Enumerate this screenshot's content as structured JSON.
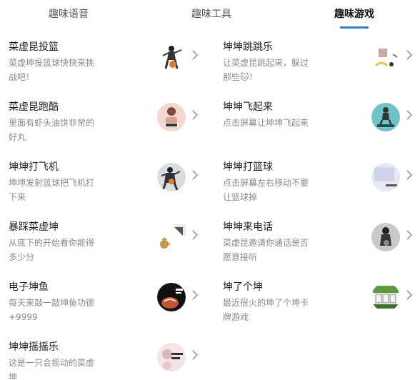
{
  "tabs": [
    {
      "label": "趣味语音"
    },
    {
      "label": "趣味工具"
    },
    {
      "label": "趣味游戏",
      "active": true
    }
  ],
  "colors": {
    "accent": "#2b7de9",
    "title": "#222222",
    "desc": "#8a8a8a",
    "chevron": "#999999"
  },
  "games": [
    {
      "title": "菜虚昆投篮",
      "desc": "菜虚坤投篮球快快来挑战吧！",
      "icon": "basketball-player-thumbnail"
    },
    {
      "title": "坤坤跳跳乐",
      "desc": "让菜虚昆跳起来，躲过那些🐱！",
      "icon": "jumping-figure-thumbnail"
    },
    {
      "title": "菜虚昆跑酷",
      "desc": "里面有虾头油饼非常的好丸",
      "icon": "runner-thumbnail"
    },
    {
      "title": "坤坤飞起来",
      "desc": "点击屏幕让坤坤飞起来",
      "icon": "flying-figure-thumbnail"
    },
    {
      "title": "坤坤打飞机",
      "desc": "坤坤发射篮球把飞机打下来",
      "icon": "basketball-shooter-thumbnail"
    },
    {
      "title": "坤坤打篮球",
      "desc": "点击屏幕左右移动不要让篮球掉",
      "icon": "basketball-court-thumbnail"
    },
    {
      "title": "暴踩菜虚坤",
      "desc": "从底下的开始看你能得多少分",
      "icon": "chicken-thumbnail"
    },
    {
      "title": "坤坤来电话",
      "desc": "菜虚昆邀请你通话是否愿意接听",
      "icon": "phone-call-thumbnail"
    },
    {
      "title": "电子坤鱼",
      "desc": "每天来敲一敲坤鱼功德+9999",
      "icon": "wooden-fish-thumbnail"
    },
    {
      "title": "坤了个坤",
      "desc": "最近很火的坤了个坤卡牌游戏",
      "icon": "card-game-thumbnail"
    },
    {
      "title": "坤坤摇摇乐",
      "desc": "这是一只会摇动的菜虚坤",
      "icon": "shaking-figure-thumbnail"
    }
  ]
}
